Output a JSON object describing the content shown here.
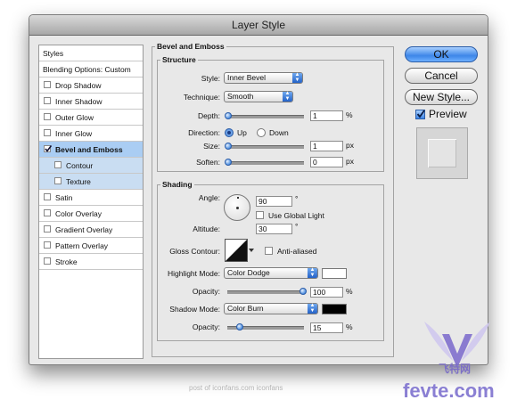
{
  "dialog": {
    "title": "Layer Style"
  },
  "styles_panel": {
    "items": [
      {
        "label": "Styles",
        "checkbox": false,
        "checked": false
      },
      {
        "label": "Blending Options: Custom",
        "checkbox": false,
        "checked": false
      },
      {
        "label": "Drop Shadow",
        "checkbox": true,
        "checked": false
      },
      {
        "label": "Inner Shadow",
        "checkbox": true,
        "checked": false
      },
      {
        "label": "Outer Glow",
        "checkbox": true,
        "checked": false
      },
      {
        "label": "Inner Glow",
        "checkbox": true,
        "checked": false
      },
      {
        "label": "Bevel and Emboss",
        "checkbox": true,
        "checked": true,
        "selected": true
      },
      {
        "label": "Contour",
        "checkbox": true,
        "checked": false,
        "sub": true
      },
      {
        "label": "Texture",
        "checkbox": true,
        "checked": false,
        "sub": true
      },
      {
        "label": "Satin",
        "checkbox": true,
        "checked": false
      },
      {
        "label": "Color Overlay",
        "checkbox": true,
        "checked": false
      },
      {
        "label": "Gradient Overlay",
        "checkbox": true,
        "checked": false
      },
      {
        "label": "Pattern Overlay",
        "checkbox": true,
        "checked": false
      },
      {
        "label": "Stroke",
        "checkbox": true,
        "checked": false
      }
    ]
  },
  "bevel": {
    "section_title": "Bevel and Emboss",
    "structure_title": "Structure",
    "style_label": "Style:",
    "style_value": "Inner Bevel",
    "technique_label": "Technique:",
    "technique_value": "Smooth",
    "depth_label": "Depth:",
    "depth_value": "1",
    "depth_unit": "%",
    "depth_level": 0.0,
    "direction_label": "Direction:",
    "direction_up": "Up",
    "direction_down": "Down",
    "direction_selected": "Up",
    "size_label": "Size:",
    "size_value": "1",
    "size_unit": "px",
    "size_level": 0.0,
    "soften_label": "Soften:",
    "soften_value": "0",
    "soften_unit": "px",
    "soften_level": 0.0
  },
  "shading": {
    "title": "Shading",
    "angle_label": "Angle:",
    "angle_value": "90",
    "angle_unit": "°",
    "use_global_light": "Use Global Light",
    "use_global_light_checked": false,
    "altitude_label": "Altitude:",
    "altitude_value": "30",
    "altitude_unit": "°",
    "gloss_contour_label": "Gloss Contour:",
    "anti_aliased": "Anti-aliased",
    "anti_aliased_checked": false,
    "highlight_mode_label": "Highlight Mode:",
    "highlight_mode_value": "Color Dodge",
    "highlight_color": "#ffffff",
    "highlight_opacity_label": "Opacity:",
    "highlight_opacity_value": "100",
    "highlight_opacity_unit": "%",
    "highlight_opacity_level": 1.0,
    "shadow_mode_label": "Shadow Mode:",
    "shadow_mode_value": "Color Burn",
    "shadow_color": "#000000",
    "shadow_opacity_label": "Opacity:",
    "shadow_opacity_value": "15",
    "shadow_opacity_unit": "%",
    "shadow_opacity_level": 0.15
  },
  "buttons": {
    "ok": "OK",
    "cancel": "Cancel",
    "new_style": "New Style...",
    "preview": "Preview",
    "preview_checked": true
  },
  "footer": {
    "credit": "post of iconfans.com iconfans"
  },
  "watermark": {
    "logo_text": "飞特网",
    "site_text": "fevte.com"
  }
}
